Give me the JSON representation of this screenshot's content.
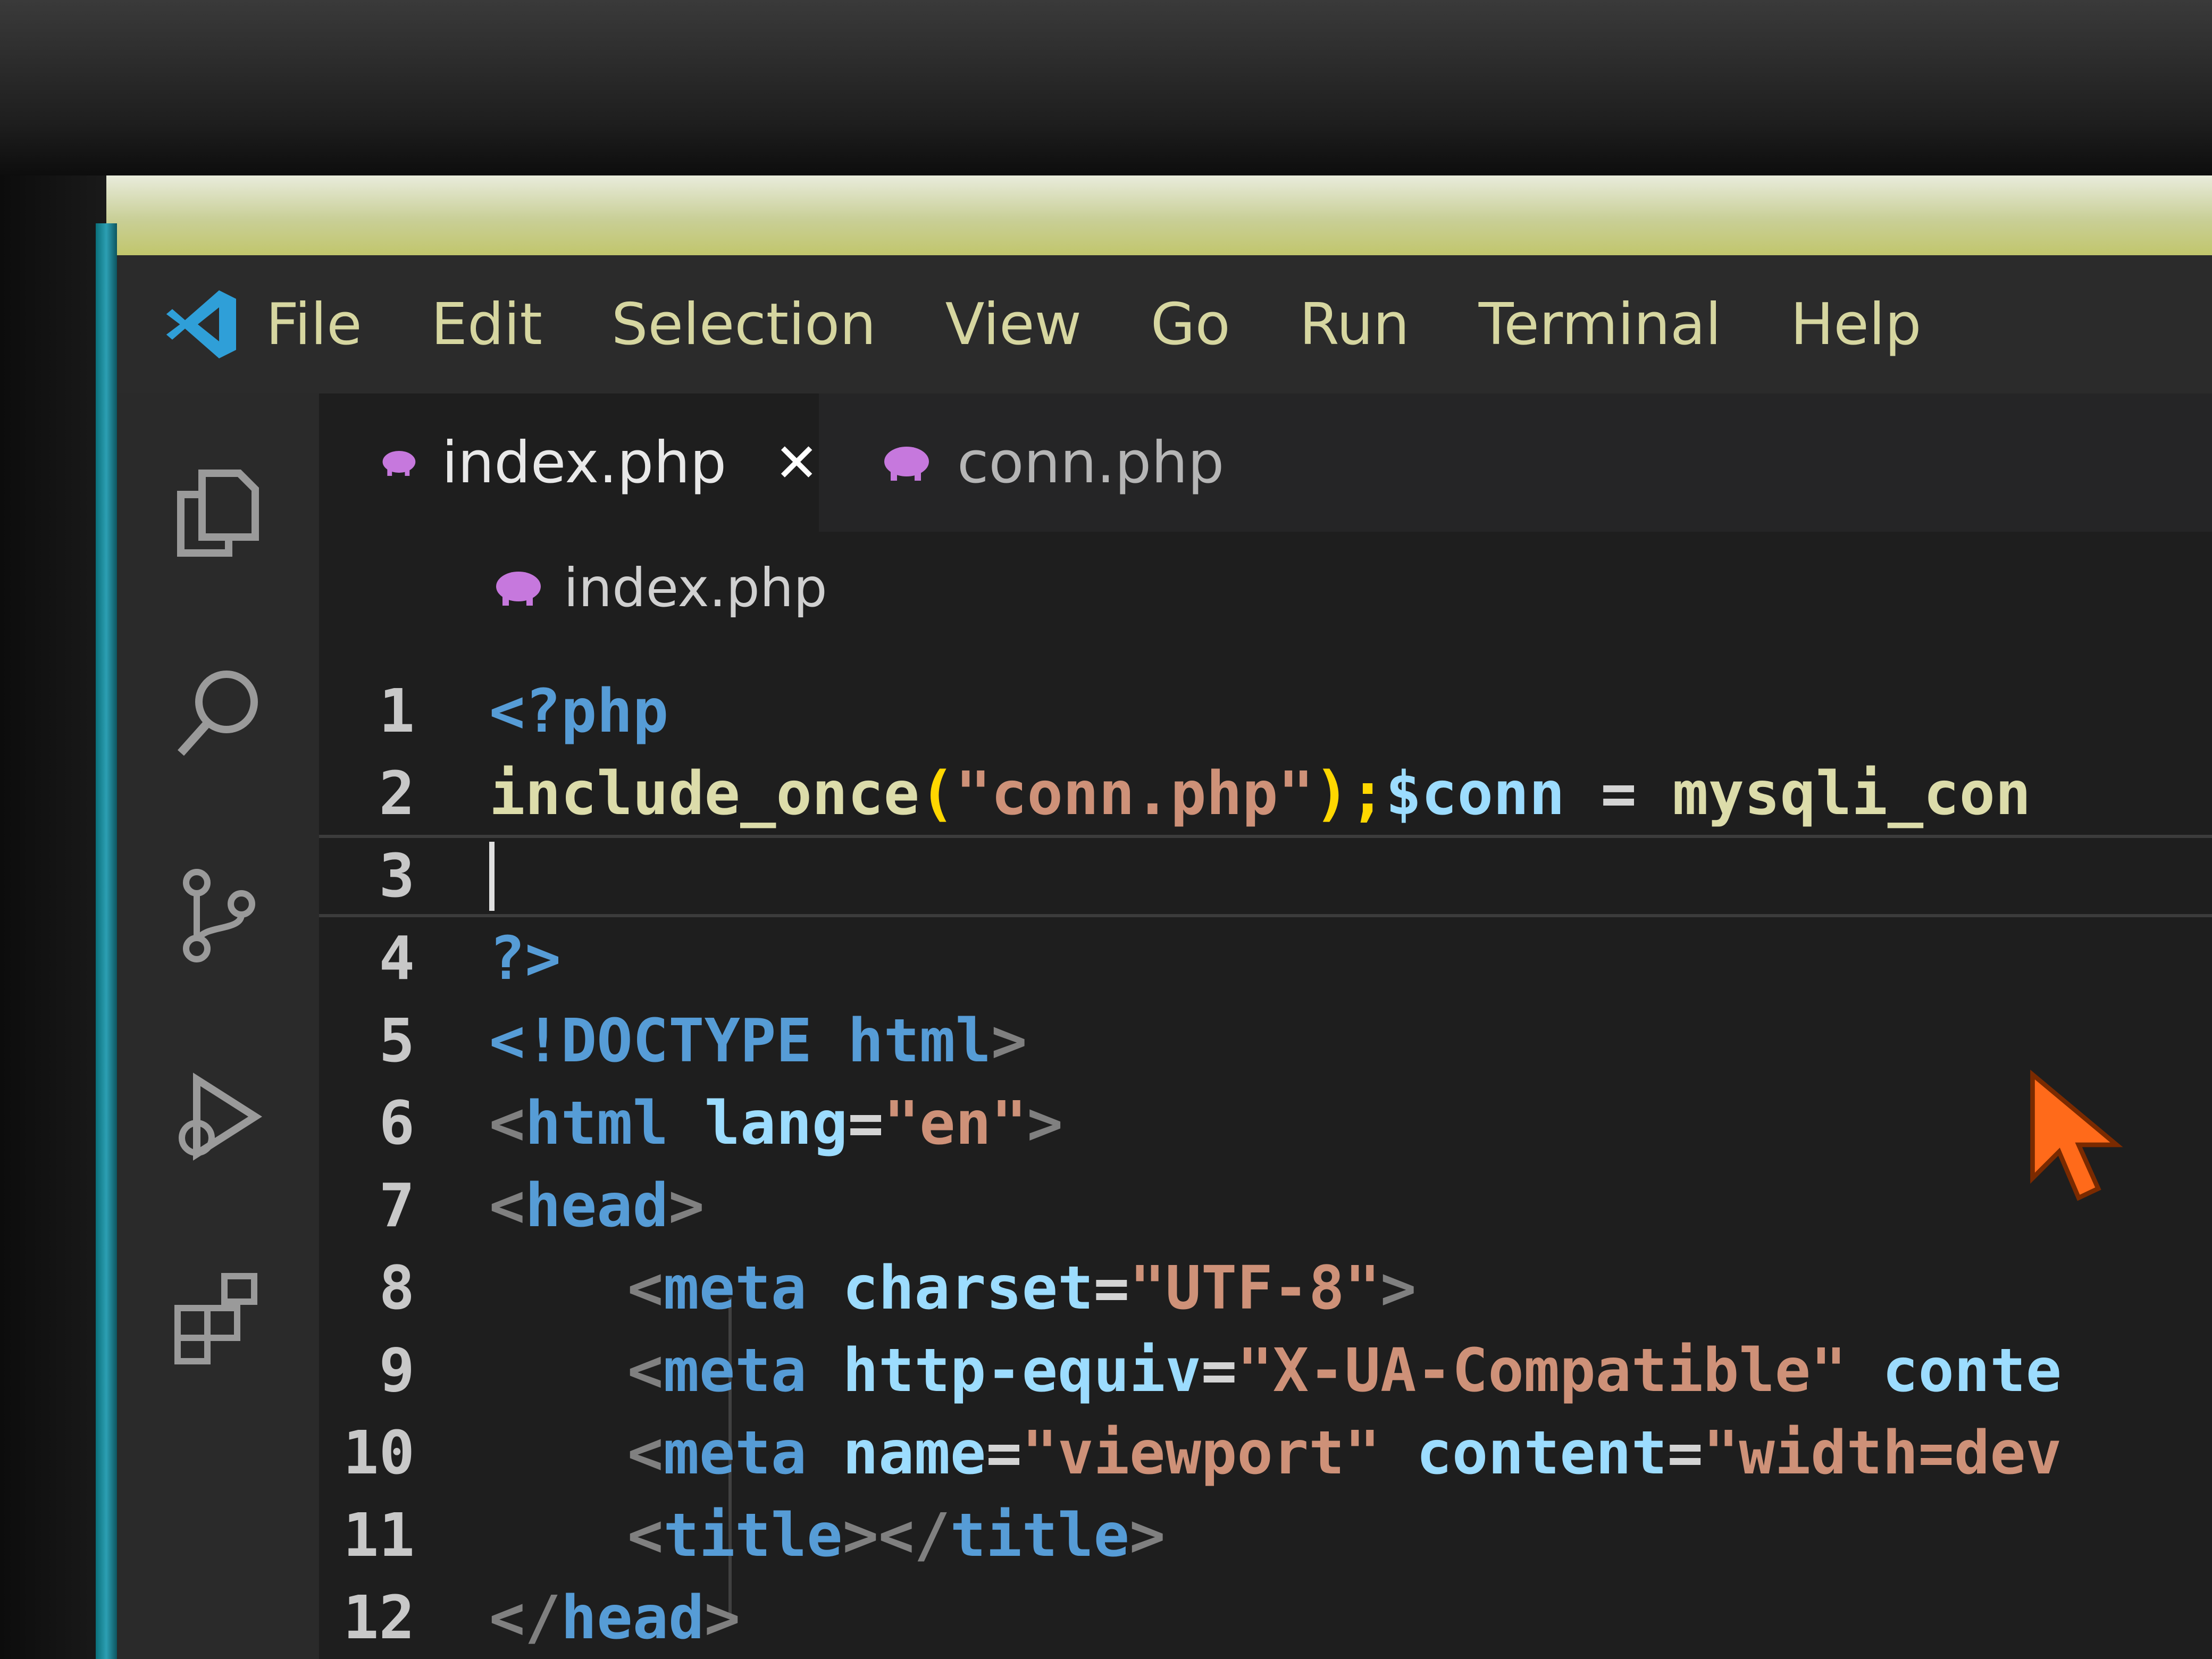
{
  "menu": [
    "File",
    "Edit",
    "Selection",
    "View",
    "Go",
    "Run",
    "Terminal",
    "Help"
  ],
  "tabs": [
    {
      "label": "index.php",
      "icon": "php-elephant-icon",
      "active": true
    },
    {
      "label": "conn.php",
      "icon": "php-elephant-icon",
      "active": false
    }
  ],
  "breadcrumb": {
    "file": "index.php"
  },
  "editor": {
    "line_numbers": [
      "1",
      "2",
      "3",
      "4",
      "5",
      "6",
      "7",
      "8",
      "9",
      "10",
      "11",
      "12"
    ],
    "l1": "<?php",
    "l2": {
      "a": "include_once",
      "b": "(",
      "c": "\"conn.php\"",
      "d": ");",
      "e": "$conn",
      "f": " = ",
      "g": "mysqli_con"
    },
    "l4": "?>",
    "l5": {
      "a": "<!DOCTYPE ",
      "b": "html",
      "c": ">"
    },
    "l6": {
      "a": "<",
      "b": "html",
      "c": " lang",
      "d": "=",
      "e": "\"en\"",
      "f": ">"
    },
    "l7": {
      "a": "<",
      "b": "head",
      "c": ">"
    },
    "l8": {
      "a": "<",
      "b": "meta",
      "c": " charset",
      "d": "=",
      "e": "\"UTF-8\"",
      "f": ">"
    },
    "l9": {
      "a": "<",
      "b": "meta",
      "c": " http-equiv",
      "d": "=",
      "e": "\"X-UA-Compatible\"",
      "f": " conte"
    },
    "l10": {
      "a": "<",
      "b": "meta",
      "c": " name",
      "d": "=",
      "e": "\"viewport\"",
      "f": " content",
      "g": "=",
      "h": "\"width=dev"
    },
    "l11": {
      "a": "<",
      "b": "title",
      "c": "></",
      "d": "title",
      "e": ">"
    },
    "l12": {
      "a": "</",
      "b": "head",
      "c": ">"
    }
  },
  "colors": {
    "keyword_blue": "#569cd6",
    "string": "#ce9178",
    "attribute": "#9cdcfe",
    "function": "#dcdcaa",
    "menu_text": "#d6d6a0",
    "accent_teal": "#2c9fb3",
    "php_icon": "#c678dd",
    "mouse_pointer": "#ff6a1a"
  }
}
